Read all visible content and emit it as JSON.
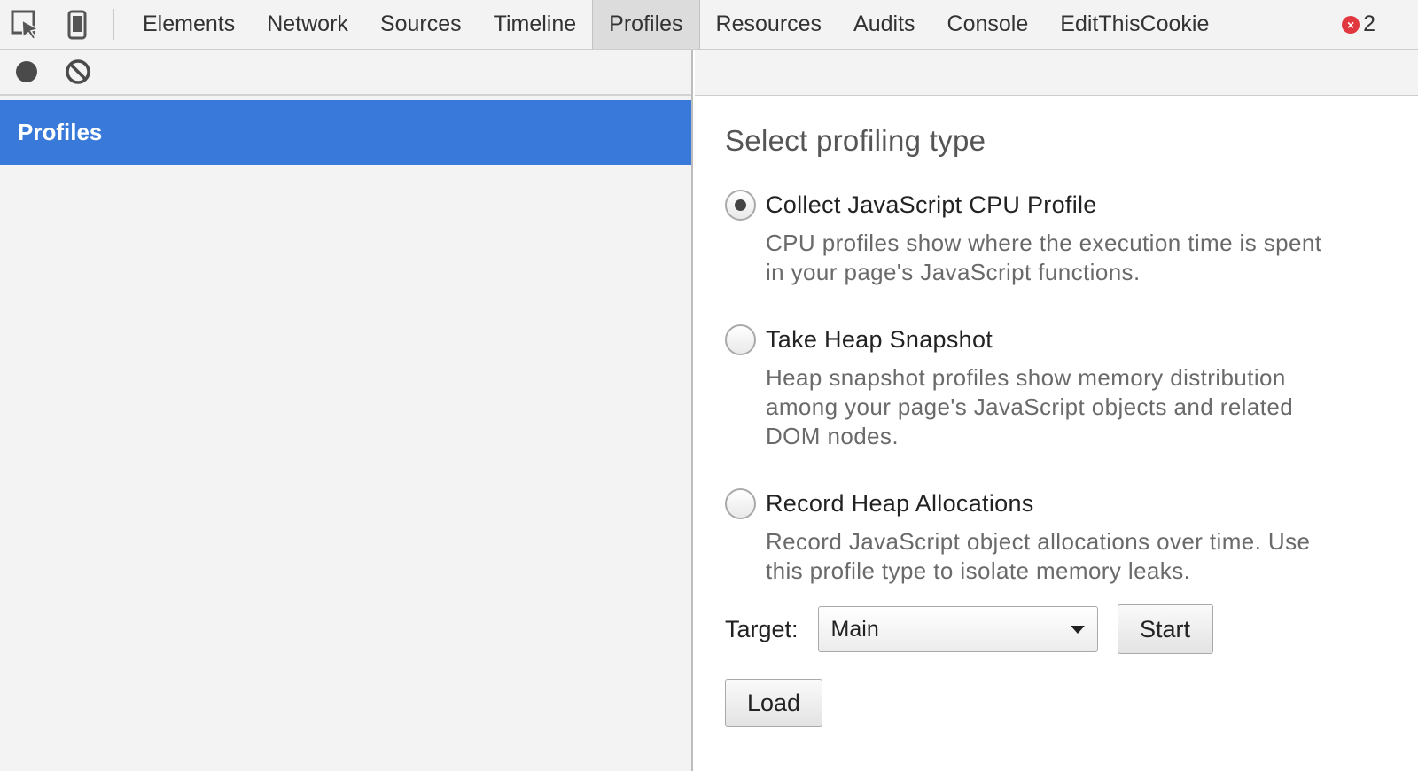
{
  "tabbar": {
    "icons": [
      "inspect-element-icon",
      "device-mode-icon"
    ],
    "tabs": [
      {
        "label": "Elements",
        "active": false
      },
      {
        "label": "Network",
        "active": false
      },
      {
        "label": "Sources",
        "active": false
      },
      {
        "label": "Timeline",
        "active": false
      },
      {
        "label": "Profiles",
        "active": true
      },
      {
        "label": "Resources",
        "active": false
      },
      {
        "label": "Audits",
        "active": false
      },
      {
        "label": "Console",
        "active": false
      },
      {
        "label": "EditThisCookie",
        "active": false
      }
    ],
    "error_count": "2",
    "error_icon_glyph": "×"
  },
  "sidebar": {
    "toolbar_icons": [
      "record-icon",
      "clear-icon"
    ],
    "selected_item": "Profiles"
  },
  "panel": {
    "title": "Select profiling type",
    "options": [
      {
        "label": "Collect JavaScript CPU Profile",
        "desc_lines": [
          "CPU profiles show where the execution time is spent",
          "in your page's JavaScript functions."
        ],
        "checked": true
      },
      {
        "label": "Take Heap Snapshot",
        "desc_lines": [
          "Heap snapshot profiles show memory distribution",
          "among your page's JavaScript objects and related",
          "DOM nodes."
        ],
        "checked": false
      },
      {
        "label": "Record Heap Allocations",
        "desc_lines": [
          "Record JavaScript object allocations over time. Use",
          "this profile type to isolate memory leaks."
        ],
        "checked": false
      }
    ],
    "target_label": "Target:",
    "target_value": "Main",
    "start_label": "Start",
    "load_label": "Load"
  },
  "colors": {
    "selection": "#3879d9",
    "error": "#e0383e",
    "toolbar_bg": "#f3f3f3"
  }
}
